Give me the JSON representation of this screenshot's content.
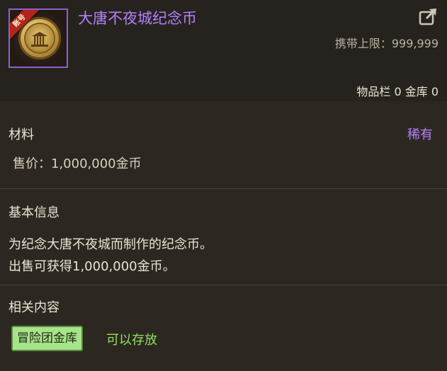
{
  "item": {
    "name": "大唐不夜城纪念币",
    "badge": "账号",
    "icon": "commemorative-coin-icon"
  },
  "carry_limit": {
    "label": "携带上限：",
    "value": "999,999"
  },
  "inventory": {
    "text": "物品栏 0  金库 0"
  },
  "type_label": "材料",
  "rarity": "稀有",
  "price": {
    "label": "售价：",
    "value": "1,000,000金币"
  },
  "basic_info": {
    "title": "基本信息",
    "lines": [
      "为纪念大唐不夜城而制作的纪念币。",
      "出售可获得1,000,000金币。"
    ]
  },
  "related": {
    "title": "相关内容",
    "tag": "冒险团金库",
    "note": "可以存放"
  },
  "colors": {
    "rarity_purple": "#b580ff",
    "storable_green": "#8fe05f",
    "tag_bg": "#a7e38a"
  }
}
